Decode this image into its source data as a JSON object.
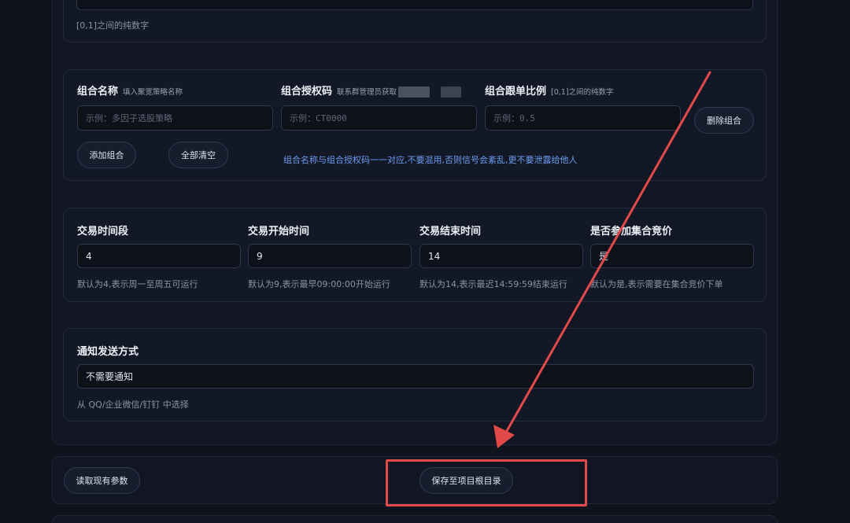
{
  "top": {
    "hint": "[0,1]之间的纯数字"
  },
  "combo": {
    "name_label": "组合名称",
    "name_sub": "填入聚宽策略名称",
    "name_placeholder": "示例：多因子选股策略",
    "code_label": "组合授权码",
    "code_sub": "联系群管理员获取",
    "code_placeholder": "示例：CT0000",
    "ratio_label": "组合跟单比例",
    "ratio_sub": "[0,1]之间的纯数字",
    "ratio_placeholder": "示例：0.5",
    "delete_button": "删除组合",
    "add_button": "添加组合",
    "clear_button": "全部清空",
    "notice": "组合名称与组合授权码一一对应,不要混用,否则信号会紊乱,更不要泄露给他人"
  },
  "trading": {
    "period_label": "交易时间段",
    "period_value": "4",
    "period_hint": "默认为4,表示周一至周五可运行",
    "start_label": "交易开始时间",
    "start_value": "9",
    "start_hint": "默认为9,表示最早09:00:00开始运行",
    "end_label": "交易结束时间",
    "end_value": "14",
    "end_hint": "默认为14,表示最迟14:59:59结束运行",
    "auction_label": "是否参加集合竞价",
    "auction_value": "是",
    "auction_hint": "默认为是,表示需要在集合竞价下单"
  },
  "notify": {
    "label": "通知发送方式",
    "value": "不需要通知",
    "hint": "从 QQ/企业微信/钉钉 中选择"
  },
  "actions": {
    "read_button": "读取现有参数",
    "save_button": "保存至项目根目录"
  },
  "annotation": {
    "color": "#e24a4a"
  }
}
